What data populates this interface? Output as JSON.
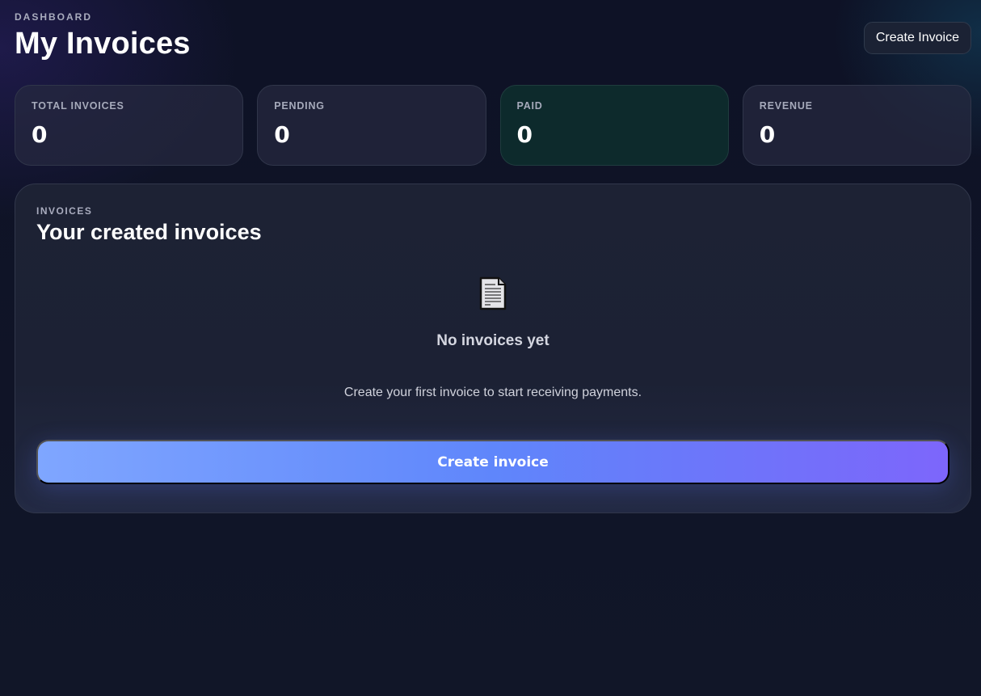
{
  "header": {
    "eyebrow": "DASHBOARD",
    "title": "My Invoices",
    "create_button": "Create Invoice"
  },
  "stats": [
    {
      "label": "TOTAL INVOICES",
      "value": "0"
    },
    {
      "label": "PENDING",
      "value": "0"
    },
    {
      "label": "PAID",
      "value": "0"
    },
    {
      "label": "REVENUE",
      "value": "0"
    }
  ],
  "panel": {
    "eyebrow": "INVOICES",
    "title": "Your created invoices",
    "empty": {
      "icon": "document-icon",
      "title": "No invoices yet",
      "text": "Create your first invoice to start receiving payments.",
      "button": "Create invoice"
    }
  },
  "colors": {
    "background": "#111628",
    "accent_start": "#7fa6ff",
    "accent_end": "#7d66fb",
    "paid_card": "#0d2a2c"
  }
}
